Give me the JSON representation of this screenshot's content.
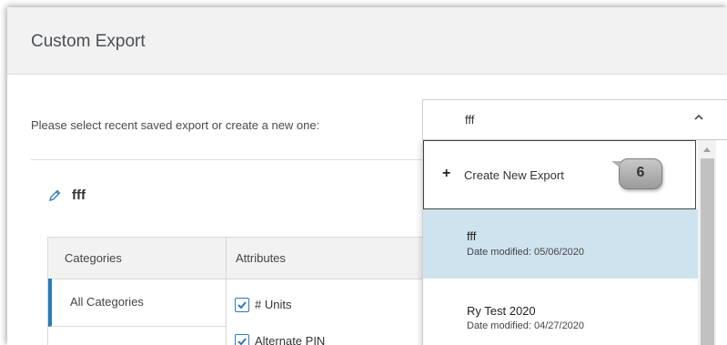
{
  "header": {
    "title": "Custom Export"
  },
  "prompt": "Please select recent saved export or create a new one:",
  "select": {
    "value": "fff"
  },
  "edit": {
    "name": "fff"
  },
  "table": {
    "headers": {
      "categories": "Categories",
      "attributes": "Attributes"
    },
    "categories": [
      "All Categories"
    ],
    "attributes": [
      {
        "label": "# Units",
        "checked": true
      },
      {
        "label": "Alternate PIN",
        "checked": true
      }
    ]
  },
  "dropdown": {
    "create_label": "Create New Export",
    "badge": "6",
    "options": [
      {
        "name": "fff",
        "date": "Date modified: 05/06/2020",
        "selected": true
      },
      {
        "name": "Ry Test 2020",
        "date": "Date modified: 04/27/2020",
        "selected": false
      }
    ]
  },
  "colors": {
    "accent": "#2b7bb9",
    "selected_bg": "#cfe3ef",
    "header_bg": "#f2f2f2"
  },
  "icons": [
    "pencil-icon",
    "chevron-up-icon",
    "plus-icon",
    "check-icon",
    "scroll-up-arrow-icon"
  ]
}
